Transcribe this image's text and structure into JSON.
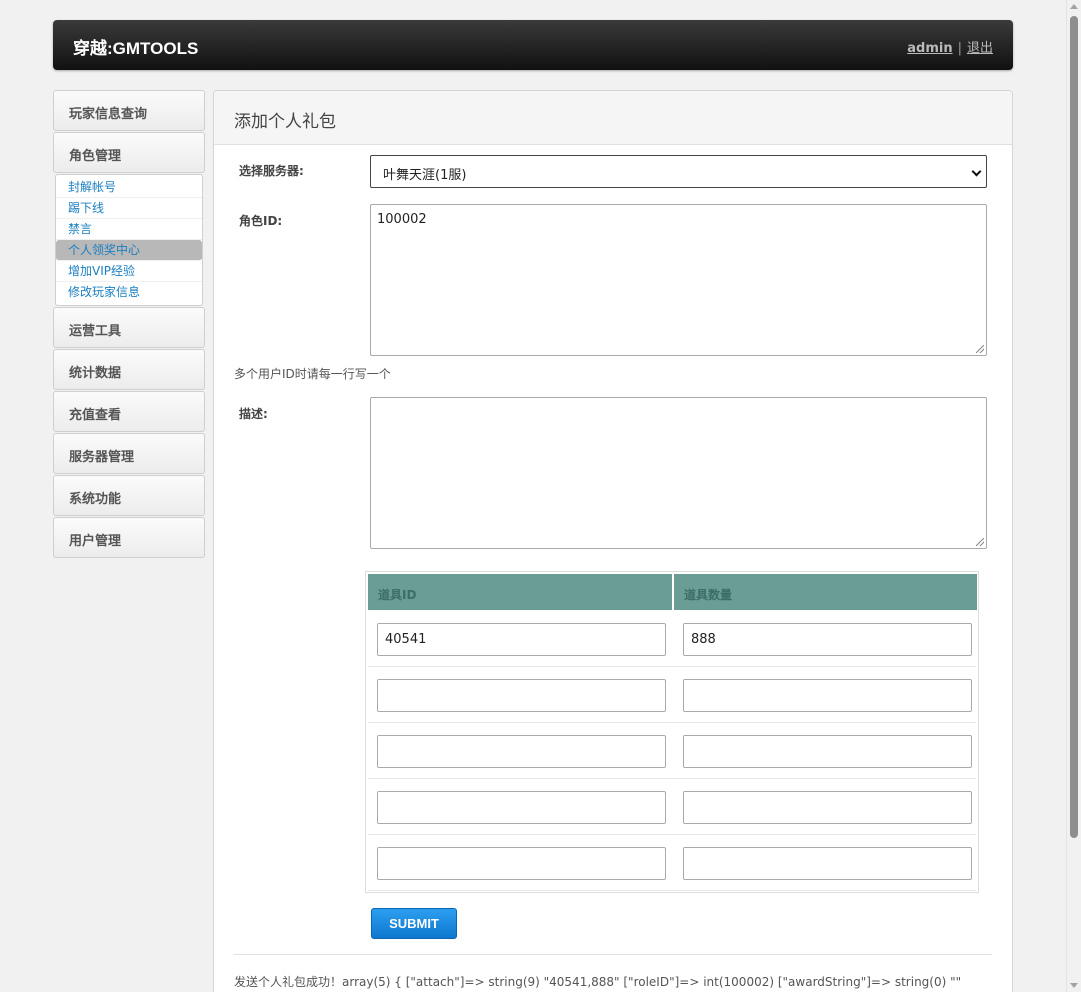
{
  "header": {
    "brand": "穿越:GMTOOLS",
    "user": "admin",
    "separator": "|",
    "logout": "退出"
  },
  "sidebar": {
    "groups": [
      {
        "label": "玩家信息查询"
      },
      {
        "label": "角色管理"
      },
      {
        "label": "运营工具"
      },
      {
        "label": "统计数据"
      },
      {
        "label": "充值查看"
      },
      {
        "label": "服务器管理"
      },
      {
        "label": "系统功能"
      },
      {
        "label": "用户管理"
      }
    ],
    "role_submenu": [
      {
        "label": "封解帐号"
      },
      {
        "label": "踢下线"
      },
      {
        "label": "禁言"
      },
      {
        "label": "个人领奖中心",
        "active": true
      },
      {
        "label": "增加VIP经验"
      },
      {
        "label": "修改玩家信息"
      }
    ]
  },
  "panel": {
    "title": "添加个人礼包",
    "server_label": "选择服务器:",
    "server_value": "叶舞天涯(1服)",
    "role_id_label": "角色ID:",
    "role_id_value": "100002",
    "hint": "多个用户ID时请每一行写一个",
    "desc_label": "描述:",
    "desc_value": "",
    "table": {
      "headers": [
        "道具ID",
        "道具数量"
      ],
      "rows": [
        [
          "40541",
          "888"
        ],
        [
          "",
          ""
        ],
        [
          "",
          ""
        ],
        [
          "",
          ""
        ],
        [
          "",
          ""
        ]
      ]
    },
    "submit": "SUBMIT",
    "result": "发送个人礼包成功！array(5) { [\"attach\"]=> string(9) \"40541,888\" [\"roleID\"]=> int(100002) [\"awardString\"]=> string(0) \"\""
  },
  "colors": {
    "header_bg": "#1e1e1e",
    "table_header_bg": "#6a9e94",
    "link_blue": "#1a7fc1",
    "submit_blue": "#1a8ae0"
  }
}
